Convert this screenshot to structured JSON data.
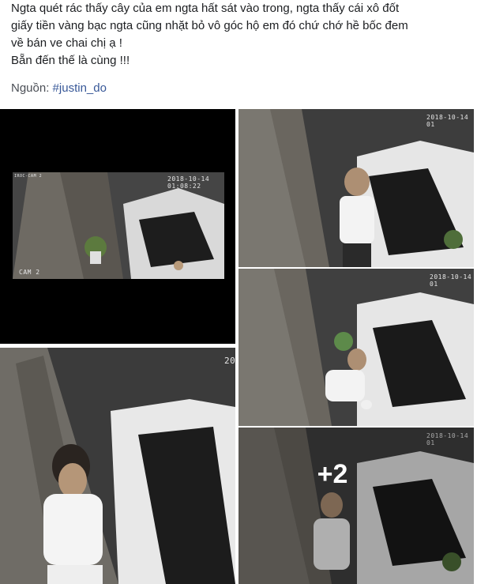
{
  "post": {
    "lines": [
      "Ngta quét rác thấy cây của em ngta hất sát vào trong, ngta thấy cái xô đốt",
      "giấy tiền vàng bạc ngta cũng nhặt bỏ vô góc hộ em đó chứ chớ hề bốc đem",
      "về bán ve chai chị ạ !",
      "Bẵn đến thế là cùng !!!"
    ],
    "source_label": "Nguồn:",
    "source_tag": "#justin_do"
  },
  "photos": {
    "p1": {
      "timestamp": "2018-10-14 01:08:22",
      "cam_label": "CAM 2",
      "corner_label": "IROC-CAM 2"
    },
    "p2": {
      "timestamp": "2018-10-14 01"
    },
    "p3": {
      "timestamp": "2018-10-14 01"
    },
    "p4": {
      "timestamp": "20"
    },
    "p5": {
      "timestamp": "2018-10-14 01"
    }
  },
  "more_photos_label": "+2"
}
